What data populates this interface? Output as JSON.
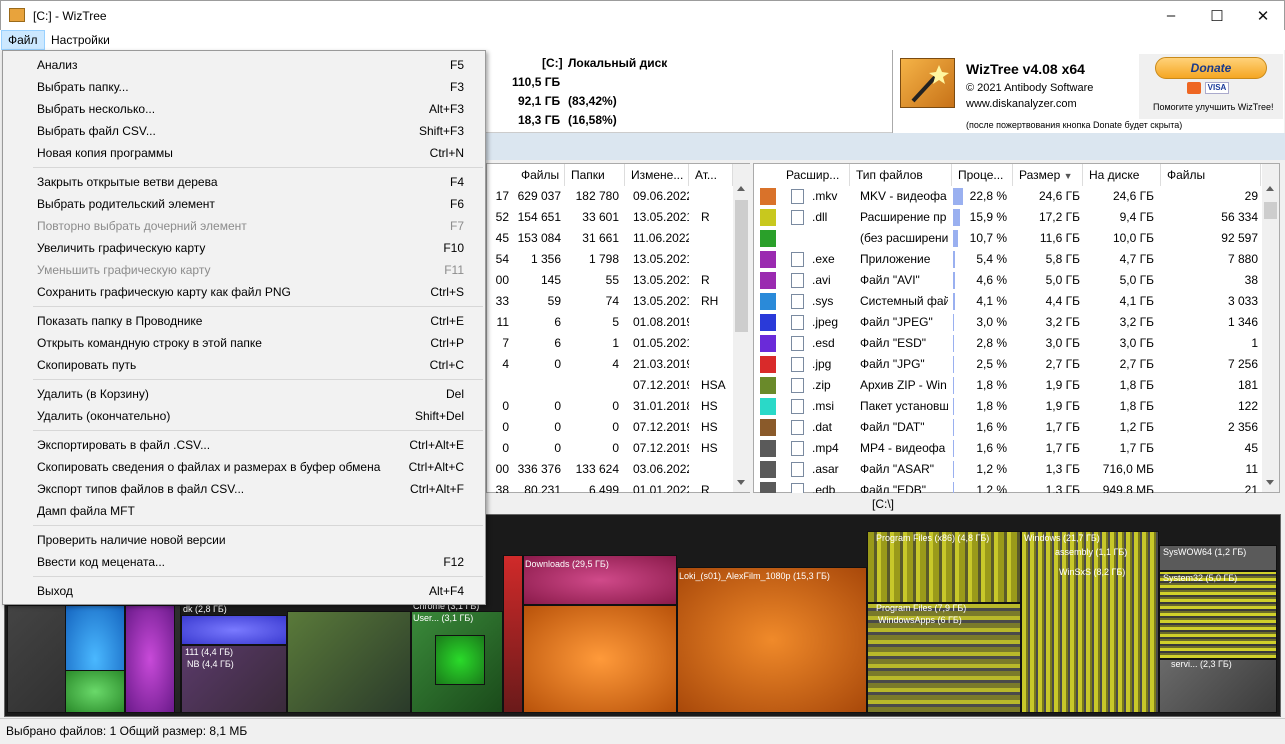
{
  "window": {
    "title": "[C:]  - WizTree"
  },
  "menubar": {
    "file": "Файл",
    "settings": "Настройки"
  },
  "info": {
    "drive_label": "[C:]",
    "drive_name": "Локальный диск",
    "total": "110,5 ГБ",
    "used": "92,1 ГБ",
    "used_pct": "(83,42%)",
    "free": "18,3 ГБ",
    "free_pct": "(16,58%)"
  },
  "logo": {
    "title": "WizTree v4.08 x64",
    "copyright": "© 2021 Antibody Software",
    "url": "www.diskanalyzer.com",
    "donate_note": "(после пожертвования кнопка Donate будет скрыта)",
    "donate": "Donate",
    "donate_caption": "Помогите улучшить WizTree!",
    "cards": "VISA"
  },
  "left_table": {
    "headers": [
      "Файлы",
      "Папки",
      "Измене...",
      "Ат..."
    ],
    "rows": [
      {
        "pre": "17",
        "files": "629 037",
        "folders": "182 780",
        "date": "09.06.2022",
        "attr": ""
      },
      {
        "pre": "52",
        "files": "154 651",
        "folders": "33 601",
        "date": "13.05.2021",
        "attr": "R"
      },
      {
        "pre": "45",
        "files": "153 084",
        "folders": "31 661",
        "date": "11.06.2022",
        "attr": ""
      },
      {
        "pre": "54",
        "files": "1 356",
        "folders": "1 798",
        "date": "13.05.2021",
        "attr": ""
      },
      {
        "pre": "00",
        "files": "145",
        "folders": "55",
        "date": "13.05.2021",
        "attr": "R"
      },
      {
        "pre": "33",
        "files": "59",
        "folders": "74",
        "date": "13.05.2021",
        "attr": "RH"
      },
      {
        "pre": "11",
        "files": "6",
        "folders": "5",
        "date": "01.08.2019",
        "attr": ""
      },
      {
        "pre": "7",
        "files": "6",
        "folders": "1",
        "date": "01.05.2021",
        "attr": ""
      },
      {
        "pre": "4",
        "files": "0",
        "folders": "4",
        "date": "21.03.2019",
        "attr": ""
      },
      {
        "pre": "",
        "files": "",
        "folders": "",
        "date": "07.12.2019",
        "attr": "HSA"
      },
      {
        "pre": "0",
        "files": "0",
        "folders": "0",
        "date": "31.01.2018",
        "attr": "HS"
      },
      {
        "pre": "0",
        "files": "0",
        "folders": "0",
        "date": "07.12.2019",
        "attr": "HS"
      },
      {
        "pre": "0",
        "files": "0",
        "folders": "0",
        "date": "07.12.2019",
        "attr": "HS"
      },
      {
        "pre": "00",
        "files": "336 376",
        "folders": "133 624",
        "date": "03.06.2022",
        "attr": ""
      },
      {
        "pre": "38",
        "files": "80 231",
        "folders": "6 499",
        "date": "01.01.2022",
        "attr": "R"
      }
    ]
  },
  "right_table": {
    "headers": [
      "Расшир...",
      "Тип файлов",
      "Проце...",
      "Размер",
      "На диске",
      "Файлы"
    ],
    "rows": [
      {
        "color": "#d9722a",
        "icon": "video-file-icon",
        "ext": ".mkv",
        "type": "MKV - видеофа",
        "pct": "22,8 %",
        "pctv": 22.8,
        "size": "24,6 ГБ",
        "disk": "24,6 ГБ",
        "files": "29"
      },
      {
        "color": "#c8c81e",
        "icon": "settings-file-icon",
        "ext": ".dll",
        "type": "Расширение пр",
        "pct": "15,9 %",
        "pctv": 15.9,
        "size": "17,2 ГБ",
        "disk": "9,4 ГБ",
        "files": "56 334"
      },
      {
        "color": "#2aa02a",
        "icon": "",
        "ext": "",
        "type": "(без расширени",
        "pct": "10,7 %",
        "pctv": 10.7,
        "size": "11,6 ГБ",
        "disk": "10,0 ГБ",
        "files": "92 597"
      },
      {
        "color": "#9a2ab0",
        "icon": "app-file-icon",
        "ext": ".exe",
        "type": "Приложение",
        "pct": "5,4 %",
        "pctv": 5.4,
        "size": "5,8 ГБ",
        "disk": "4,7 ГБ",
        "files": "7 880"
      },
      {
        "color": "#9a2ab0",
        "icon": "audio-file-icon",
        "ext": ".avi",
        "type": "Файл \"AVI\"",
        "pct": "4,6 %",
        "pctv": 4.6,
        "size": "5,0 ГБ",
        "disk": "5,0 ГБ",
        "files": "38"
      },
      {
        "color": "#2a8ad9",
        "icon": "system-file-icon",
        "ext": ".sys",
        "type": "Системный фай",
        "pct": "4,1 %",
        "pctv": 4.1,
        "size": "4,4 ГБ",
        "disk": "4,1 ГБ",
        "files": "3 033"
      },
      {
        "color": "#2a3ad9",
        "icon": "image-file-icon",
        "ext": ".jpeg",
        "type": "Файл \"JPEG\"",
        "pct": "3,0 %",
        "pctv": 3.0,
        "size": "3,2 ГБ",
        "disk": "3,2 ГБ",
        "files": "1 346"
      },
      {
        "color": "#6a2ad9",
        "icon": "generic-file-icon",
        "ext": ".esd",
        "type": "Файл \"ESD\"",
        "pct": "2,8 %",
        "pctv": 2.8,
        "size": "3,0 ГБ",
        "disk": "3,0 ГБ",
        "files": "1"
      },
      {
        "color": "#d92a2a",
        "icon": "image-file-icon",
        "ext": ".jpg",
        "type": "Файл \"JPG\"",
        "pct": "2,5 %",
        "pctv": 2.5,
        "size": "2,7 ГБ",
        "disk": "2,7 ГБ",
        "files": "7 256"
      },
      {
        "color": "#6a8a2a",
        "icon": "archive-file-icon",
        "ext": ".zip",
        "type": "Архив ZIP - Win",
        "pct": "1,8 %",
        "pctv": 1.8,
        "size": "1,9 ГБ",
        "disk": "1,8 ГБ",
        "files": "181"
      },
      {
        "color": "#2ad9c8",
        "icon": "installer-file-icon",
        "ext": ".msi",
        "type": "Пакет установщ",
        "pct": "1,8 %",
        "pctv": 1.8,
        "size": "1,9 ГБ",
        "disk": "1,8 ГБ",
        "files": "122"
      },
      {
        "color": "#8a5a2a",
        "icon": "generic-file-icon",
        "ext": ".dat",
        "type": "Файл \"DAT\"",
        "pct": "1,6 %",
        "pctv": 1.6,
        "size": "1,7 ГБ",
        "disk": "1,2 ГБ",
        "files": "2 356"
      },
      {
        "color": "#5a5a5a",
        "icon": "video-file-icon",
        "ext": ".mp4",
        "type": "MP4 - видеофа",
        "pct": "1,6 %",
        "pctv": 1.6,
        "size": "1,7 ГБ",
        "disk": "1,7 ГБ",
        "files": "45"
      },
      {
        "color": "#5a5a5a",
        "icon": "generic-file-icon",
        "ext": ".asar",
        "type": "Файл \"ASAR\"",
        "pct": "1,2 %",
        "pctv": 1.2,
        "size": "1,3 ГБ",
        "disk": "716,0 МБ",
        "files": "11"
      },
      {
        "color": "#5a5a5a",
        "icon": "generic-file-icon",
        "ext": ".edb",
        "type": "Файл \"EDB\"",
        "pct": "1,2 %",
        "pctv": 1.2,
        "size": "1,3 ГБ",
        "disk": "949,8 МБ",
        "files": "21"
      }
    ]
  },
  "path": "[C:\\]",
  "treemap": {
    "labels": [
      "Downloads (29,5 ГБ)",
      "Loki_(s01)_AlexFilm_1080p (15,3 ГБ)",
      "Program Files (x86) (4,8 ГБ)",
      "Windows (21,7 ГБ)",
      "assembly (1,1 ГБ)",
      "SysWOW64 (1,2 ГБ)",
      "System32 (5,0 ГБ)",
      "WinSxS (8,2 ГБ)",
      "Program Files (7,9 ГБ)",
      "WindowsApps (6 ГБ)",
      "servi... (2,3 ГБ)",
      "dk (2,8 ГБ)",
      "111 (4,4 ГБ)",
      "NB (4,4 ГБ)",
      "Chrome (3,1 ГБ)",
      "User... (3,1 ГБ)"
    ]
  },
  "status": "Выбрано файлов: 1  Общий размер: 8,1 МБ",
  "menu": [
    {
      "label": "Анализ",
      "sc": "F5",
      "dis": false
    },
    {
      "label": "Выбрать папку...",
      "sc": "F3",
      "dis": false
    },
    {
      "label": "Выбрать несколько...",
      "sc": "Alt+F3",
      "dis": false
    },
    {
      "label": "Выбрать файл CSV...",
      "sc": "Shift+F3",
      "dis": false
    },
    {
      "label": "Новая копия программы",
      "sc": "Ctrl+N",
      "dis": false
    },
    {
      "sep": true
    },
    {
      "label": "Закрыть открытые ветви дерева",
      "sc": "F4",
      "dis": false
    },
    {
      "label": "Выбрать родительский элемент",
      "sc": "F6",
      "dis": false
    },
    {
      "label": "Повторно выбрать дочерний элемент",
      "sc": "F7",
      "dis": true
    },
    {
      "label": "Увеличить графическую карту",
      "sc": "F10",
      "dis": false
    },
    {
      "label": "Уменьшить графическую карту",
      "sc": "F11",
      "dis": true
    },
    {
      "label": "Сохранить графическую карту как файл PNG",
      "sc": "Ctrl+S",
      "dis": false
    },
    {
      "sep": true
    },
    {
      "label": "Показать папку в Проводнике",
      "sc": "Ctrl+E",
      "dis": false
    },
    {
      "label": "Открыть командную строку в этой папке",
      "sc": "Ctrl+P",
      "dis": false
    },
    {
      "label": "Скопировать путь",
      "sc": "Ctrl+C",
      "dis": false
    },
    {
      "sep": true
    },
    {
      "label": "Удалить (в Корзину)",
      "sc": "Del",
      "dis": false
    },
    {
      "label": "Удалить (окончательно)",
      "sc": "Shift+Del",
      "dis": false
    },
    {
      "sep": true
    },
    {
      "label": "Экспортировать в файл .CSV...",
      "sc": "Ctrl+Alt+E",
      "dis": false
    },
    {
      "label": "Скопировать сведения о файлах и размерах в буфер обмена",
      "sc": "Ctrl+Alt+C",
      "dis": false
    },
    {
      "label": "Экспорт типов файлов в файл CSV...",
      "sc": "Ctrl+Alt+F",
      "dis": false
    },
    {
      "label": "Дамп файла MFT",
      "sc": "",
      "dis": false
    },
    {
      "sep": true
    },
    {
      "label": "Проверить наличие новой версии",
      "sc": "",
      "dis": false
    },
    {
      "label": "Ввести код мецената...",
      "sc": "F12",
      "dis": false
    },
    {
      "sep": true
    },
    {
      "label": "Выход",
      "sc": "Alt+F4",
      "dis": false
    }
  ]
}
